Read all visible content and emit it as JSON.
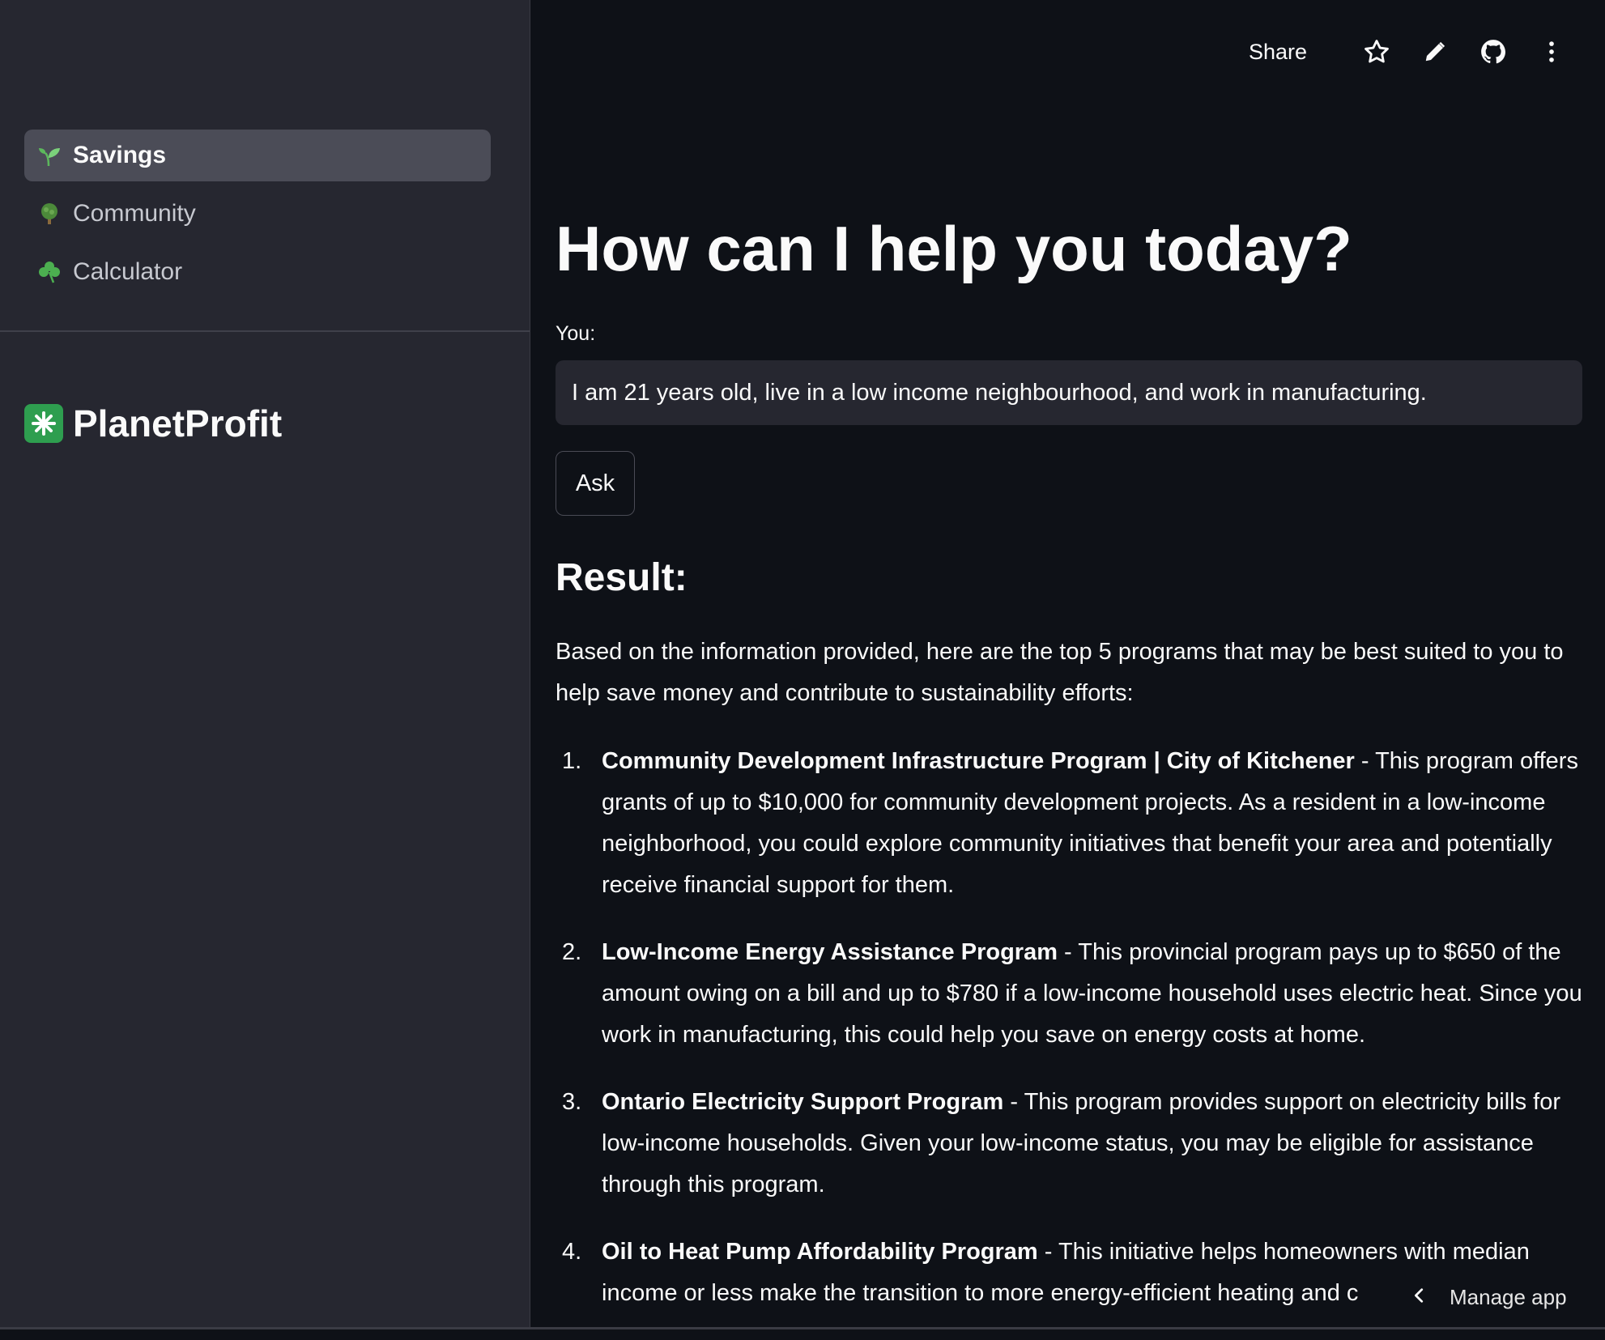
{
  "sidebar": {
    "nav": [
      {
        "label": "Savings",
        "icon": "seedling-icon",
        "active": true
      },
      {
        "label": "Community",
        "icon": "tree-icon",
        "active": false
      },
      {
        "label": "Calculator",
        "icon": "shamrock-icon",
        "active": false
      }
    ],
    "brand": {
      "name": "PlanetProfit",
      "icon": "sparkle-icon"
    }
  },
  "toolbar": {
    "share_label": "Share",
    "icons": [
      "star-icon",
      "pencil-icon",
      "github-icon",
      "more-vertical-icon"
    ]
  },
  "main": {
    "title": "How can I help you today?",
    "you_label": "You:",
    "input_value": "I am 21 years old, live in a low income neighbourhood, and work in manufacturing.",
    "ask_label": "Ask",
    "result_heading": "Result:",
    "intro": "Based on the information provided, here are the top 5 programs that may be best suited to you to help save money and contribute to sustainability efforts:",
    "programs": [
      {
        "num": "1.",
        "name": "Community Development Infrastructure Program | City of Kitchener",
        "desc": " - This program offers grants of up to $10,000 for community development projects. As a resident in a low-income neighborhood, you could explore community initiatives that benefit your area and potentially receive financial support for them."
      },
      {
        "num": "2.",
        "name": "Low-Income Energy Assistance Program",
        "desc": " - This provincial program pays up to $650 of the amount owing on a bill and up to $780 if a low-income household uses electric heat. Since you work in manufacturing, this could help you save on energy costs at home."
      },
      {
        "num": "3.",
        "name": "Ontario Electricity Support Program",
        "desc": " - This program provides support on electricity bills for low-income households. Given your low-income status, you may be eligible for assistance through this program."
      },
      {
        "num": "4.",
        "name": "Oil to Heat Pump Affordability Program",
        "desc": " - This initiative helps homeowners with median income or less make the transition to more energy-efficient heating and c"
      }
    ]
  },
  "manage_app": {
    "label": "Manage app",
    "icon": "chevron-left-icon"
  },
  "colors": {
    "sidebar_bg": "#262730",
    "main_bg": "#0e1117",
    "active_item_bg": "#4b4c57",
    "brand_green": "#2e9e4f"
  }
}
